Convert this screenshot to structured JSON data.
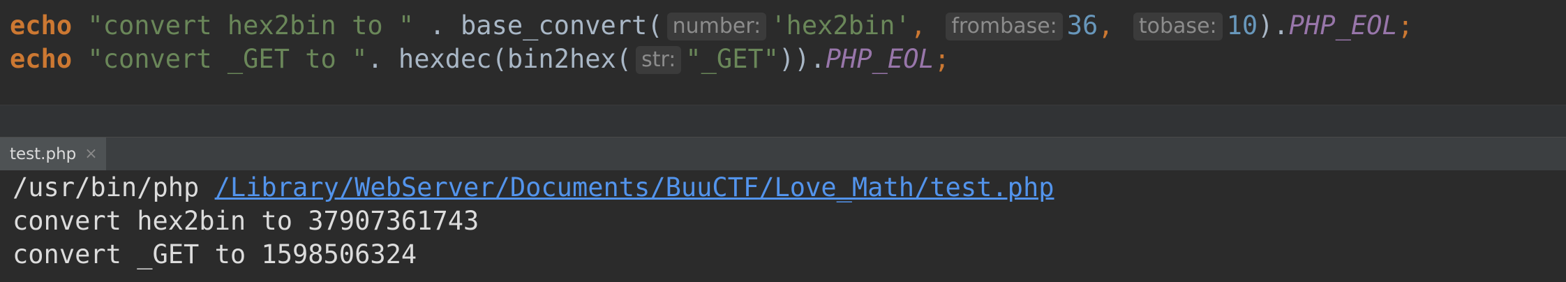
{
  "editor": {
    "line1": {
      "keyword": "echo",
      "string1": "\"convert hex2bin to \"",
      "op1": " . ",
      "func": "base_convert(",
      "hint_number": "number:",
      "arg_string": "'hex2bin'",
      "comma1": ",",
      "hint_frombase": "frombase:",
      "arg_frombase": "36",
      "comma2": ",",
      "hint_tobase": "tobase:",
      "arg_tobase": "10",
      "close": ").",
      "const": "PHP_EOL",
      "semi": ";"
    },
    "line2": {
      "keyword": "echo",
      "string1": "\"convert _GET to \"",
      "op1": ". ",
      "func": "hexdec(bin2hex(",
      "hint_str": "str:",
      "arg_string": "\"_GET\"",
      "close": ")).",
      "const": "PHP_EOL",
      "semi": ";"
    }
  },
  "run_panel": {
    "tab_label": "test.php",
    "tab_close": "×",
    "console": {
      "cmd": "/usr/bin/php",
      "path": "/Library/WebServer/Documents/BuuCTF/Love_Math/test.php",
      "output1": "convert hex2bin to 37907361743",
      "output2": "convert _GET to 1598506324"
    }
  },
  "colors": {
    "background": "#2b2b2b",
    "keyword": "#cc7832",
    "string": "#6a8759",
    "number": "#6897bb",
    "constant": "#9876aa",
    "link": "#5394ec"
  }
}
